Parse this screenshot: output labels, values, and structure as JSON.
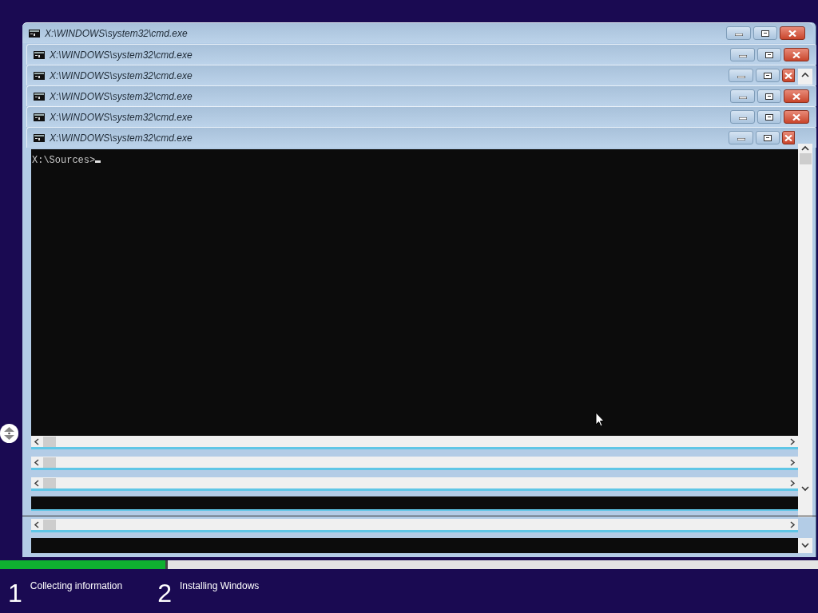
{
  "windows": [
    {
      "title": "X:\\WINDOWS\\system32\\cmd.exe"
    },
    {
      "title": "X:\\WINDOWS\\system32\\cmd.exe"
    },
    {
      "title": "X:\\WINDOWS\\system32\\cmd.exe"
    },
    {
      "title": "X:\\WINDOWS\\system32\\cmd.exe"
    },
    {
      "title": "X:\\WINDOWS\\system32\\cmd.exe"
    },
    {
      "title": "X:\\WINDOWS\\system32\\cmd.exe"
    }
  ],
  "terminal": {
    "prompt": "X:\\Sources>"
  },
  "progress": {
    "level": 0.205
  },
  "steps": [
    {
      "number": "1",
      "label": "Collecting information"
    },
    {
      "number": "2",
      "label": "Installing Windows"
    }
  ]
}
